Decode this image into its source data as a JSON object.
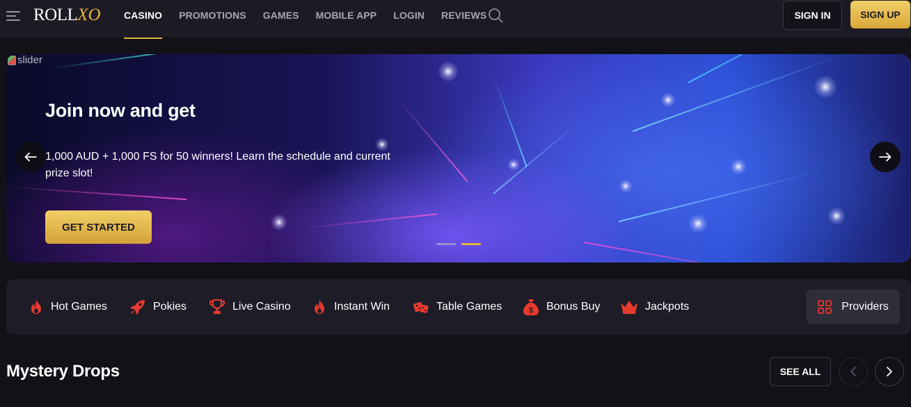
{
  "header": {
    "logo_main": "ROLL",
    "logo_accent": "XO",
    "nav": [
      {
        "label": "CASINO",
        "active": true
      },
      {
        "label": "PROMOTIONS"
      },
      {
        "label": "GAMES"
      },
      {
        "label": "MOBILE APP"
      },
      {
        "label": "LOGIN"
      },
      {
        "label": "REVIEWS"
      }
    ],
    "sign_in": "SIGN IN",
    "sign_up": "SIGN UP"
  },
  "slider": {
    "alt_text": "slider",
    "title": "Join now and get",
    "text": "1,000 AUD + 1,000 FS for 50 winners! Learn the schedule and current prize slot!",
    "cta": "GET STARTED",
    "active_dot": 2,
    "dot_count": 2
  },
  "categories": [
    {
      "label": "Hot Games",
      "icon": "flame-icon"
    },
    {
      "label": "Pokies",
      "icon": "rocket-icon"
    },
    {
      "label": "Live Casino",
      "icon": "trophy-icon"
    },
    {
      "label": "Instant Win",
      "icon": "flame-icon"
    },
    {
      "label": "Table Games",
      "icon": "dice-icon"
    },
    {
      "label": "Bonus Buy",
      "icon": "money-bag-icon"
    },
    {
      "label": "Jackpots",
      "icon": "crown-icon"
    }
  ],
  "providers": {
    "label": "Providers",
    "icon": "grid-icon"
  },
  "section": {
    "title": "Mystery Drops",
    "see_all": "SEE ALL"
  },
  "colors": {
    "accent": "#e5b53a",
    "icon_red": "#e8392f",
    "background": "#121118",
    "panel": "#1e1d27"
  }
}
